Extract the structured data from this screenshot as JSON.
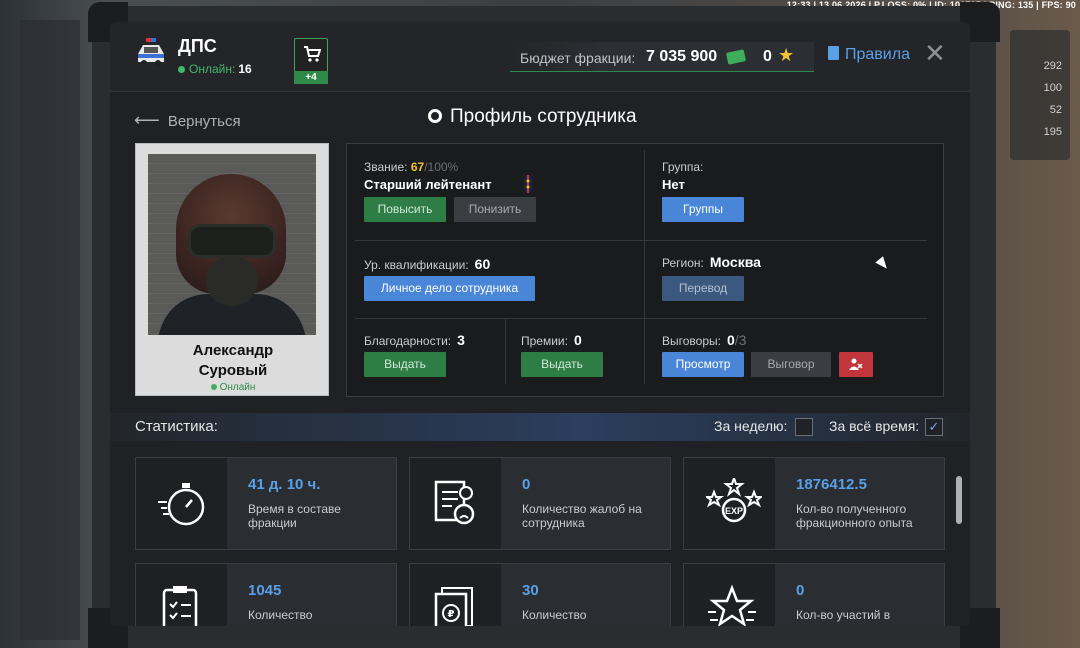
{
  "hud": {
    "text": "12:33 | 13.06.2026 | P.LOSS: 0% | ID: 100705 | PING: 135 | FPS: 90"
  },
  "background": {
    "stats": [
      "292",
      "100",
      "52",
      "195"
    ]
  },
  "header": {
    "faction_name": "ДПС",
    "online_label": "Онлайн:",
    "online_count": "16",
    "cart_badge": "+4",
    "budget_label": "Бюджет фракции:",
    "budget_value": "7 035 900",
    "stars_value": "0",
    "rules_label": "Правила",
    "close_icon": "close-icon"
  },
  "nav": {
    "back_label": "Вернуться",
    "page_title": "Профиль сотрудника"
  },
  "profile": {
    "first_name": "Александр",
    "last_name": "Суровый",
    "status": "Онлайн"
  },
  "info": {
    "rank_label": "Звание:",
    "rank_progress": "67",
    "rank_max": "/100%",
    "rank_name": "Старший лейтенант",
    "promote_button": "Повысить",
    "demote_button": "Понизить",
    "group_label": "Группа:",
    "group_value": "Нет",
    "groups_button": "Группы",
    "qualification_label": "Ур. квалификации:",
    "qualification_value": "60",
    "personal_file_button": "Личное дело сотрудника",
    "region_label": "Регион:",
    "region_value": "Москва",
    "transfer_button": "Перевод",
    "thanks_label": "Благодарности:",
    "thanks_value": "3",
    "thanks_button": "Выдать",
    "bonuses_label": "Премии:",
    "bonuses_value": "0",
    "bonuses_button": "Выдать",
    "reprimands_label": "Выговоры:",
    "reprimands_value": "0",
    "reprimands_max": "/3",
    "view_button": "Просмотр",
    "reprimand_button": "Выговор"
  },
  "stats": {
    "title": "Статистика:",
    "week_label": "За неделю:",
    "alltime_label": "За всё время:",
    "week_checked": false,
    "alltime_checked": true,
    "cards": [
      {
        "icon": "stopwatch-icon",
        "value": "41 д. 10 ч.",
        "desc": "Время в составе фракции"
      },
      {
        "icon": "complaint-document-icon",
        "value": "0",
        "desc": "Количество жалоб на сотрудника"
      },
      {
        "icon": "exp-stars-icon",
        "value": "1876412.5",
        "desc": "Кол-во полученного фракционного опыта"
      },
      {
        "icon": "clipboard-checklist-icon",
        "value": "1045",
        "desc": "Количество"
      },
      {
        "icon": "ruble-document-icon",
        "value": "30",
        "desc": "Количество"
      },
      {
        "icon": "star-award-icon",
        "value": "0",
        "desc": "Кол-во участий в"
      }
    ]
  },
  "colors": {
    "accent_blue": "#5aa0e6",
    "accent_green": "#2e7d46",
    "danger": "#c0363a",
    "gold": "#f1c232"
  }
}
